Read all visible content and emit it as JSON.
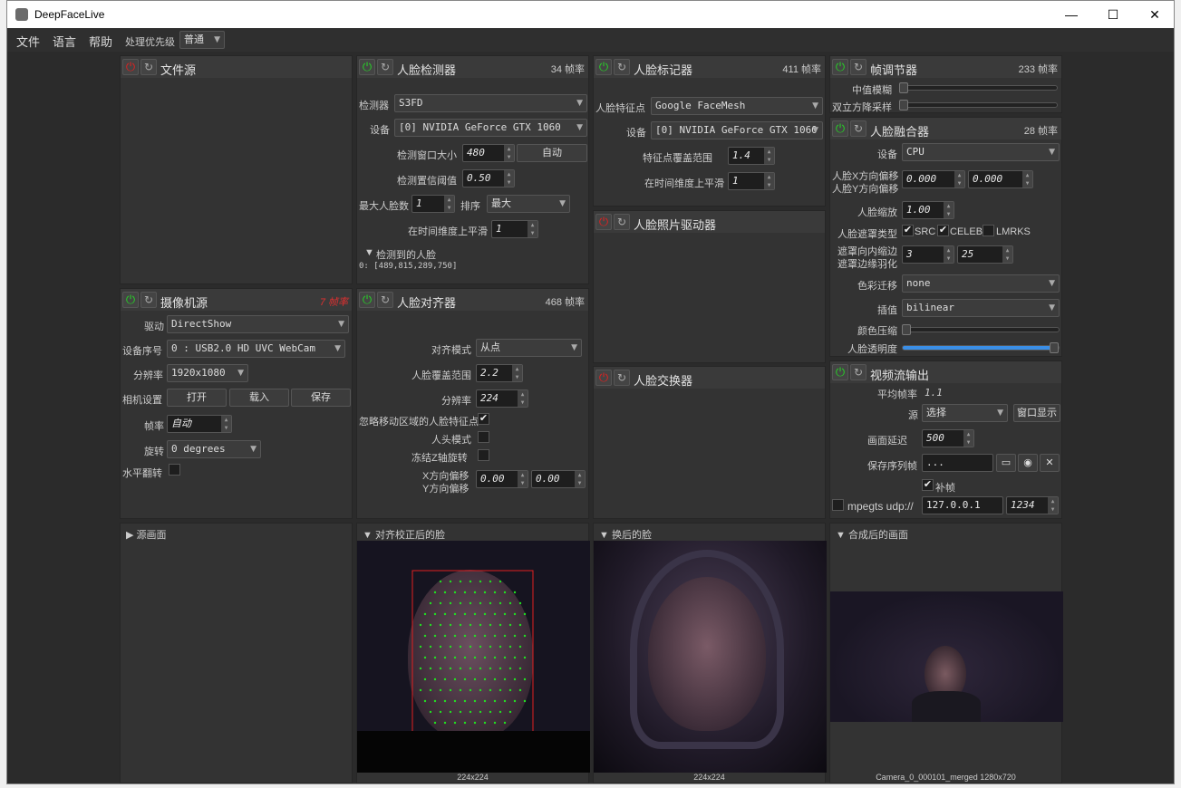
{
  "app": {
    "title": "DeepFaceLive"
  },
  "menu": {
    "file": "文件",
    "language": "语言",
    "help": "帮助",
    "priority_label": "处理优先级",
    "priority_value": "普通"
  },
  "file_source": {
    "title": "文件源"
  },
  "camera": {
    "title": "摄像机源",
    "fps_badge": "7 帧率",
    "driver_label": "驱动",
    "driver_value": "DirectShow",
    "device_label": "设备序号",
    "device_value": "0 : USB2.0 HD UVC WebCam",
    "res_label": "分辨率",
    "res_value": "1920x1080",
    "settings_label": "相机设置",
    "open": "打开",
    "load": "载入",
    "save": "保存",
    "fps_label": "帧率",
    "fps_value": "自动",
    "rotate_label": "旋转",
    "rotate_value": "0 degrees",
    "flip_label": "水平翻转"
  },
  "detector": {
    "title": "人脸检测器",
    "fps": "34 帧率",
    "detector_label": "检测器",
    "detector_value": "S3FD",
    "device_label": "设备",
    "device_value": "[0] NVIDIA GeForce GTX 1060",
    "window_label": "检测窗口大小",
    "window_value": "480",
    "auto": "自动",
    "threshold_label": "检测置信阈值",
    "threshold_value": "0.50",
    "maxfaces_label": "最大人脸数",
    "maxfaces_value": "1",
    "sort_label": "排序",
    "sort_value": "最大",
    "smooth_label": "在时间维度上平滑",
    "smooth_value": "1",
    "detected_label": "检测到的人脸",
    "detected_value": "0: [489,815,289,750]"
  },
  "marker": {
    "title": "人脸标记器",
    "fps": "411 帧率",
    "marker_label": "人脸特征点",
    "marker_value": "Google FaceMesh",
    "device_label": "设备",
    "device_value": "[0] NVIDIA GeForce GTX 1060",
    "range_label": "特征点覆盖范围",
    "range_value": "1.4",
    "smooth_label": "在时间维度上平滑",
    "smooth_value": "1"
  },
  "frame_adjuster": {
    "title": "帧调节器",
    "fps": "233 帧率",
    "median_label": "中值模糊",
    "bilateral_label": "双立方降采样"
  },
  "merger": {
    "title": "人脸融合器",
    "fps": "28 帧率",
    "device_label": "设备",
    "device_value": "CPU",
    "xoffset_label": "人脸X方向偏移",
    "yoffset_label": "人脸Y方向偏移",
    "xoffset_value": "0.000",
    "yoffset_value": "0.000",
    "scale_label": "人脸缩放",
    "scale_value": "1.00",
    "masktype_label": "人脸遮罩类型",
    "src": "SRC",
    "celeb": "CELEB",
    "lmrks": "LMRKS",
    "erode_label": "遮罩向内缩边",
    "blur_label": "遮罩边缘羽化",
    "erode_value": "3",
    "blur_value": "25",
    "color_label": "色彩迁移",
    "color_value": "none",
    "interp_label": "插值",
    "interp_value": "bilinear",
    "compress_label": "颜色压缩",
    "opacity_label": "人脸透明度"
  },
  "photo_driver": {
    "title": "人脸照片驱动器"
  },
  "aligner": {
    "title": "人脸对齐器",
    "fps": "468 帧率",
    "mode_label": "对齐模式",
    "mode_value": "从点",
    "coverage_label": "人脸覆盖范围",
    "coverage_value": "2.2",
    "res_label": "分辨率",
    "res_value": "224",
    "ignore_label": "忽略移动区域的人脸特征点",
    "head_label": "人头模式",
    "freeze_label": "冻结Z轴旋转",
    "xoff_label": "X方向偏移",
    "yoff_label": "Y方向偏移",
    "xoff_value": "0.00",
    "yoff_value": "0.00"
  },
  "swapper": {
    "title": "人脸交换器"
  },
  "stream": {
    "title": "视频流输出",
    "avgfps_label": "平均帧率",
    "avgfps_value": "1.1",
    "source_label": "源",
    "source_value": "选择",
    "window_btn": "窗口显示",
    "delay_label": "画面延迟",
    "delay_value": "500",
    "seq_label": "保存序列帧",
    "seq_value": "...",
    "fill_label": "补帧",
    "mpegts_label": "mpegts udp://",
    "ip_value": "127.0.0.1",
    "port_value": "1234"
  },
  "views": {
    "source": "源画面",
    "aligned": "对齐校正后的脸",
    "aligned_size": "224x224",
    "swapped": "换后的脸",
    "swapped_size": "224x224",
    "merged": "合成后的画面",
    "merged_caption": "Camera_0_000101_merged 1280x720"
  }
}
